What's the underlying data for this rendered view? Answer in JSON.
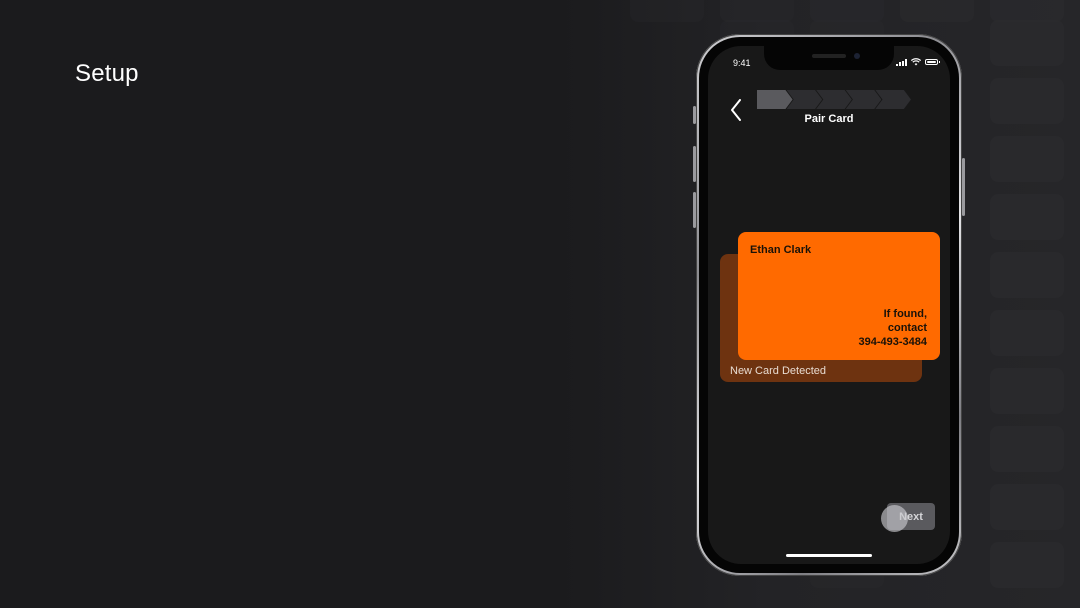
{
  "page": {
    "title": "Setup"
  },
  "phone": {
    "status_bar": {
      "time": "9:41"
    },
    "header": {
      "step_label": "Pair Card",
      "steps_total": 5,
      "steps_active": 1
    },
    "card_back": {
      "label": "New Card Detected"
    },
    "card_front": {
      "name": "Ethan Clark",
      "found_line1": "If found,",
      "found_line2": "contact",
      "phone": "394-493-3484"
    },
    "next_button": {
      "label": "Next"
    }
  },
  "colors": {
    "background": "#1b1b1d",
    "card_front": "#ff6a00",
    "card_back": "#6e3310",
    "screen": "#181818"
  },
  "icons": [
    "back-chevron-icon",
    "signal-icon",
    "wifi-icon",
    "battery-icon"
  ]
}
